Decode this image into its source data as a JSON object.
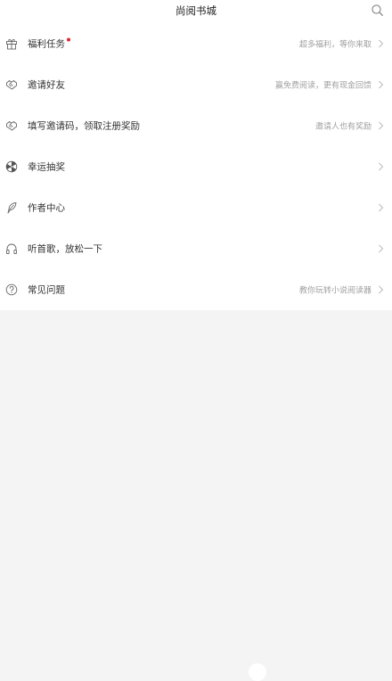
{
  "header": {
    "title": "尚阅书城",
    "search_icon": "search-icon"
  },
  "menu": {
    "items": [
      {
        "icon": "gift-icon",
        "label": "福利任务",
        "subtitle": "超多福利，等你来取",
        "has_red_dot": true
      },
      {
        "icon": "handshake-icon",
        "label": "邀请好友",
        "subtitle": "赢免费阅读，更有现金回馈",
        "has_red_dot": false
      },
      {
        "icon": "handshake-icon",
        "label": "填写邀请码，领取注册奖励",
        "subtitle": "邀请人也有奖励",
        "has_red_dot": false
      },
      {
        "icon": "lucky-wheel-icon",
        "label": "幸运抽奖",
        "subtitle": "",
        "has_red_dot": false
      },
      {
        "icon": "quill-pen-icon",
        "label": "作者中心",
        "subtitle": "",
        "has_red_dot": false
      },
      {
        "icon": "headphones-icon",
        "label": "听首歌，放松一下",
        "subtitle": "",
        "has_red_dot": false
      },
      {
        "icon": "question-circle-icon",
        "label": "常见问题",
        "subtitle": "教你玩转小说阅读器",
        "has_red_dot": false
      }
    ]
  },
  "colors": {
    "background": "#f4f4f4",
    "surface": "#ffffff",
    "text_primary": "#333333",
    "text_secondary": "#a0a0a0",
    "badge_red": "#e0262b"
  }
}
